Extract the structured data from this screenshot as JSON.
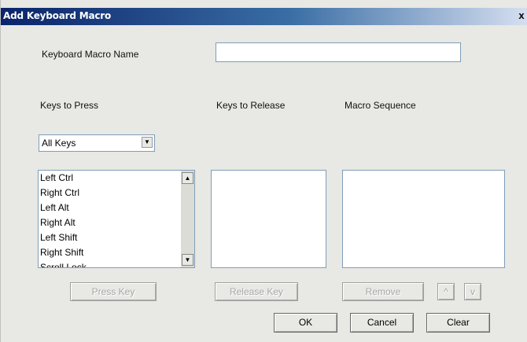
{
  "window": {
    "title": "Add Keyboard Macro",
    "close_label": "x"
  },
  "name_field": {
    "label": "Keyboard Macro Name",
    "value": ""
  },
  "columns": {
    "press": "Keys to Press",
    "release": "Keys to Release",
    "sequence": "Macro Sequence"
  },
  "filter": {
    "selected": "All Keys"
  },
  "press_list": {
    "items": [
      "Left Ctrl",
      "Right Ctrl",
      "Left Alt",
      "Right Alt",
      "Left Shift",
      "Right Shift",
      "Scroll Lock"
    ]
  },
  "buttons": {
    "press_key": "Press Key",
    "release_key": "Release Key",
    "remove": "Remove",
    "move_up": "^",
    "move_down": "v",
    "ok": "OK",
    "cancel": "Cancel",
    "clear": "Clear"
  }
}
